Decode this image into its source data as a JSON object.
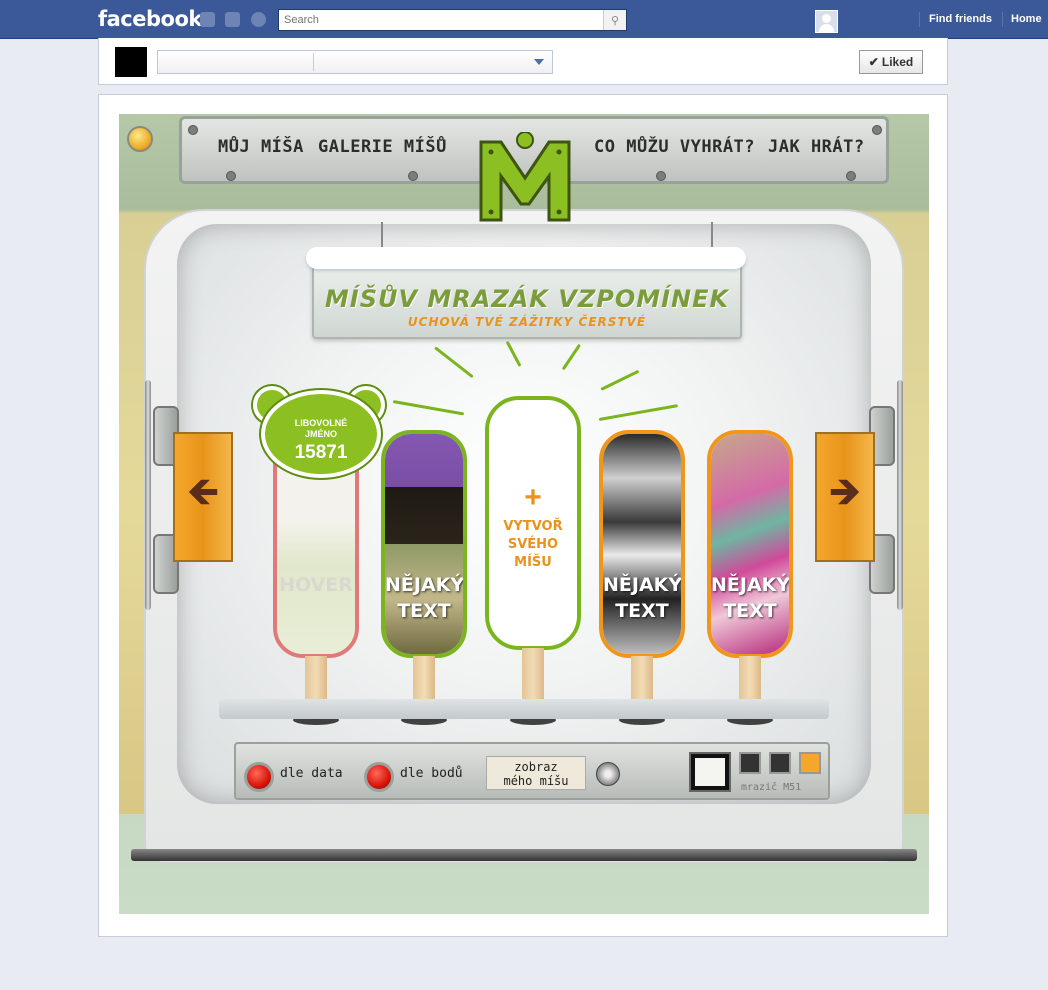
{
  "fb": {
    "logo": "facebook",
    "search_placeholder": "Search",
    "find_friends": "Find friends",
    "home": "Home"
  },
  "page": {
    "liked_label": "Liked"
  },
  "app": {
    "nav": [
      "MŮJ MÍŠA",
      "GALERIE MÍŠŮ",
      "CO MŮŽU VYHRÁT?",
      "JAK HRÁT?"
    ],
    "title": "MÍŠŮV MRAZÁK VZPOMÍNEK",
    "subtitle": "UCHOVÁ TVÉ ZÁŽITKY ČERSTVÉ",
    "badge": {
      "name_line1": "LIBOVOLNÉ",
      "name_line2": "JMÉNO",
      "number": "15871"
    },
    "popsicles": [
      {
        "text1": "",
        "text2": "HOVER",
        "border": "#e07a7a"
      },
      {
        "text1": "NĚJAKÝ",
        "text2": "TEXT",
        "border": "#7ab51e"
      },
      {
        "text1": "",
        "text2": "",
        "border": "#7ab51e"
      },
      {
        "text1": "NĚJAKÝ",
        "text2": "TEXT",
        "border": "#f0961a"
      },
      {
        "text1": "NĚJAKÝ",
        "text2": "TEXT",
        "border": "#f0961a"
      }
    ],
    "create": {
      "plus": "+",
      "line1": "VYTVOŘ",
      "line2": "SVÉHO",
      "line3": "MÍŠU"
    },
    "controls": {
      "by_date": "dle data",
      "by_points": "dle bodů",
      "show_line1": "zobraz",
      "show_line2": "mého míšu",
      "brand": "mrazič M51"
    },
    "colors": {
      "accent_green": "#7ab51e",
      "accent_orange": "#e8931c"
    }
  }
}
